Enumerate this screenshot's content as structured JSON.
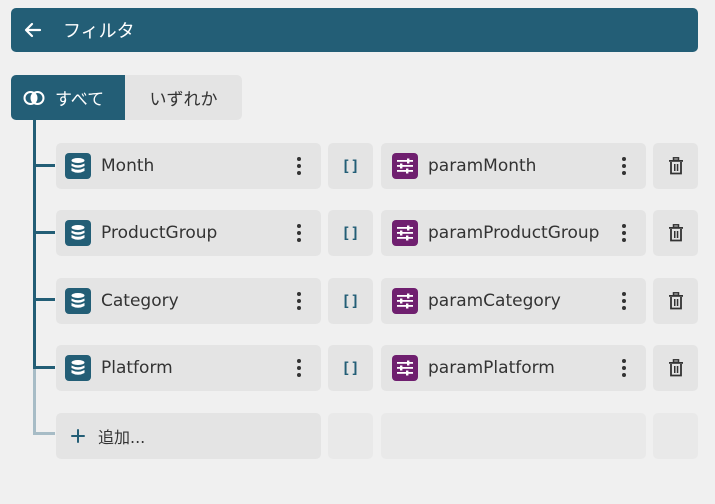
{
  "header": {
    "title": "フィルタ"
  },
  "toggle": {
    "all_label": "すべて",
    "any_label": "いずれか"
  },
  "filters": [
    {
      "field": "Month",
      "param": "paramMonth"
    },
    {
      "field": "ProductGroup",
      "param": "paramProductGroup"
    },
    {
      "field": "Category",
      "param": "paramCategory"
    },
    {
      "field": "Platform",
      "param": "paramPlatform"
    }
  ],
  "bracket_label": "[]",
  "add": {
    "label": "追加..."
  },
  "colors": {
    "primary": "#235e76",
    "param_icon": "#6f1f6f",
    "background": "#f0f0f0",
    "chip": "#e4e4e4"
  },
  "icons": {
    "back": "arrow-left-icon",
    "all": "intersect-icon",
    "field": "database-icon",
    "param": "sliders-icon",
    "more": "kebab-icon",
    "delete": "trash-icon",
    "add": "plus-icon"
  }
}
